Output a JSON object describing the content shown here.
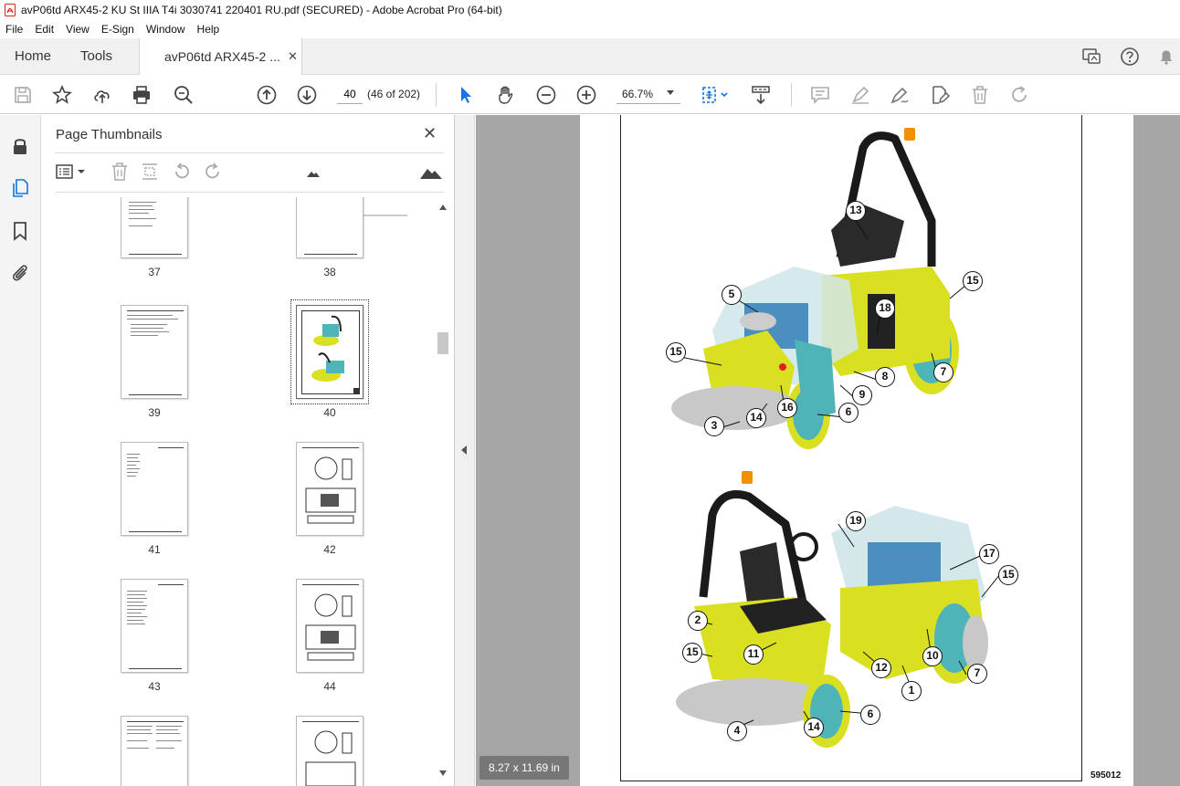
{
  "window": {
    "title": "avP06td ARX45-2 KU St IIIA T4i 3030741 220401 RU.pdf (SECURED) - Adobe Acrobat Pro (64-bit)"
  },
  "menu": [
    "File",
    "Edit",
    "View",
    "E-Sign",
    "Window",
    "Help"
  ],
  "tabs": {
    "home": "Home",
    "tools": "Tools",
    "document": "avP06td ARX45-2 ...",
    "close_glyph": "✕"
  },
  "toolbar": {
    "page_value": "40",
    "page_count": "(46 of 202)",
    "zoom": "66.7%"
  },
  "panel": {
    "title": "Page Thumbnails",
    "close_glyph": "✕"
  },
  "thumbnails": [
    {
      "label": "37"
    },
    {
      "label": "38"
    },
    {
      "label": "39"
    },
    {
      "label": "40"
    },
    {
      "label": "41"
    },
    {
      "label": "42"
    },
    {
      "label": "43"
    },
    {
      "label": "44"
    },
    {
      "label": ""
    },
    {
      "label": ""
    }
  ],
  "document": {
    "figure_code": "595012",
    "page_size": "8.27 x 11.69 in",
    "callouts_top": [
      "13",
      "5",
      "18",
      "15",
      "15",
      "7",
      "8",
      "9",
      "16",
      "6",
      "14",
      "3"
    ],
    "callouts_bottom": [
      "19",
      "17",
      "15",
      "2",
      "15",
      "11",
      "10",
      "12",
      "7",
      "1",
      "6",
      "14",
      "4"
    ]
  },
  "colors": {
    "accent": "#1473e6",
    "machine_yellow": "#d9e021",
    "machine_teal": "#4fb4b8",
    "beacon": "#f29100",
    "drum_gray": "#c8c8c8"
  }
}
